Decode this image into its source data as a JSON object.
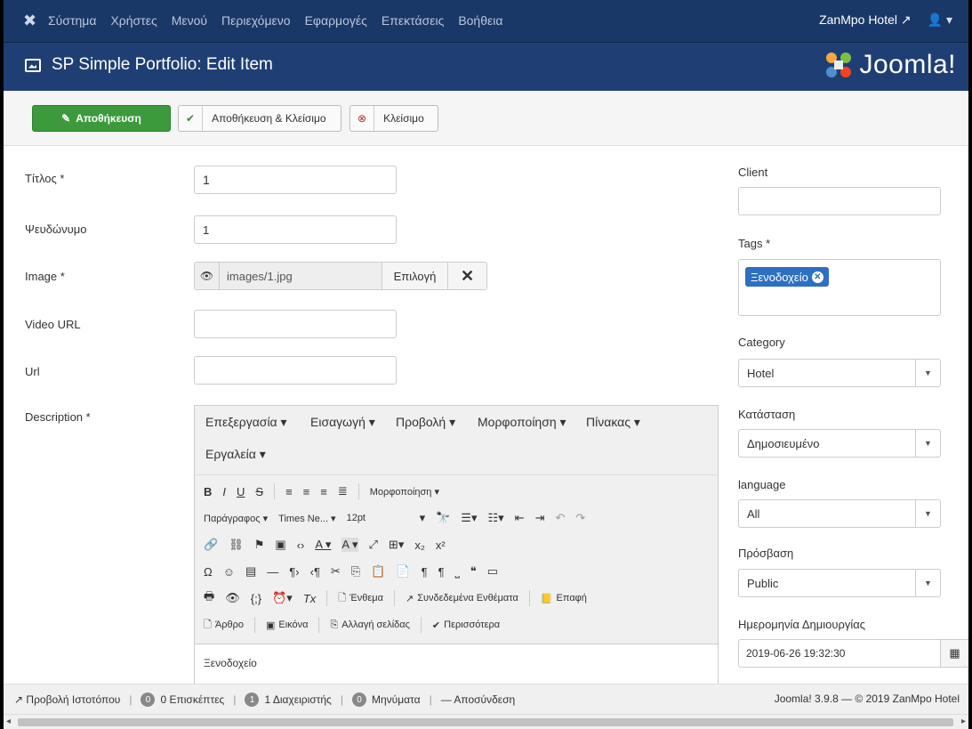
{
  "topbar": {
    "menu": [
      "Σύστημα",
      "Χρήστες",
      "Μενού",
      "Περιεχόμενο",
      "Εφαρμογές",
      "Επεκτάσεις",
      "Βοήθεια"
    ],
    "site_name": "ZanMpo Hotel",
    "user_icon": "user-icon"
  },
  "header": {
    "title": "SP Simple Portfolio: Edit Item",
    "brand": "Joomla!"
  },
  "toolbar": {
    "save": "Αποθήκευση",
    "save_close": "Αποθήκευση & Κλείσιμο",
    "close": "Κλείσιμο"
  },
  "form": {
    "title_label": "Τίτλος *",
    "title_value": "1",
    "alias_label": "Ψευδώνυμο",
    "alias_value": "1",
    "image_label": "Image *",
    "image_value": "images/1.jpg",
    "image_select": "Επιλογή",
    "video_label": "Video URL",
    "video_value": "",
    "url_label": "Url",
    "url_value": "",
    "description_label": "Description *"
  },
  "editor": {
    "menus": [
      "Επεξεργασία ▾",
      "Εισαγωγή ▾",
      "Προβολή ▾",
      "Μορφοποίηση ▾",
      "Πίνακας ▾",
      "Εργαλεία ▾"
    ],
    "format_menu": "Μορφοποίηση ▾",
    "paragraph": "Παράγραφος ▾",
    "font": "Times Ne... ▾",
    "size": "12pt",
    "btn_article_item": "Ένθεμα",
    "btn_linked_items": "Συνδεδεμένα Ενθέματα",
    "btn_contact": "Επαφή",
    "btn_article": "Άρθρο",
    "btn_image": "Εικόνα",
    "btn_pagebreak": "Αλλαγή σελίδας",
    "btn_more": "Περισσότερα",
    "content": "Ξενοδοχείο"
  },
  "right": {
    "client_label": "Client",
    "client_value": "",
    "tags_label": "Tags *",
    "tag_chip": "Ξενοδοχείο",
    "category_label": "Category",
    "category_value": "Hotel",
    "status_label": "Κατάσταση",
    "status_value": "Δημοσιευμένο",
    "language_label": "language",
    "language_value": "All",
    "access_label": "Πρόσβαση",
    "access_value": "Public",
    "created_label": "Ημερομηνία Δημιουργίας",
    "created_value": "2019-06-26 19:32:30"
  },
  "statusbar": {
    "view_site": "Προβολή Ιστοτόπου",
    "visitors_count": "0",
    "visitors": "0 Επισκέπτες",
    "admins_count": "1",
    "admins": "1 Διαχειριστής",
    "messages_count": "0",
    "messages": "Μηνύματα",
    "logout": "Αποσύνδεση",
    "version": "Joomla! 3.9.8 — © 2019 ZanMpo Hotel"
  },
  "colors": {
    "navbar": "#1a3867",
    "header": "#1f3f74",
    "save_button": "#3c9a3c",
    "tag_chip": "#2d6fc0"
  }
}
